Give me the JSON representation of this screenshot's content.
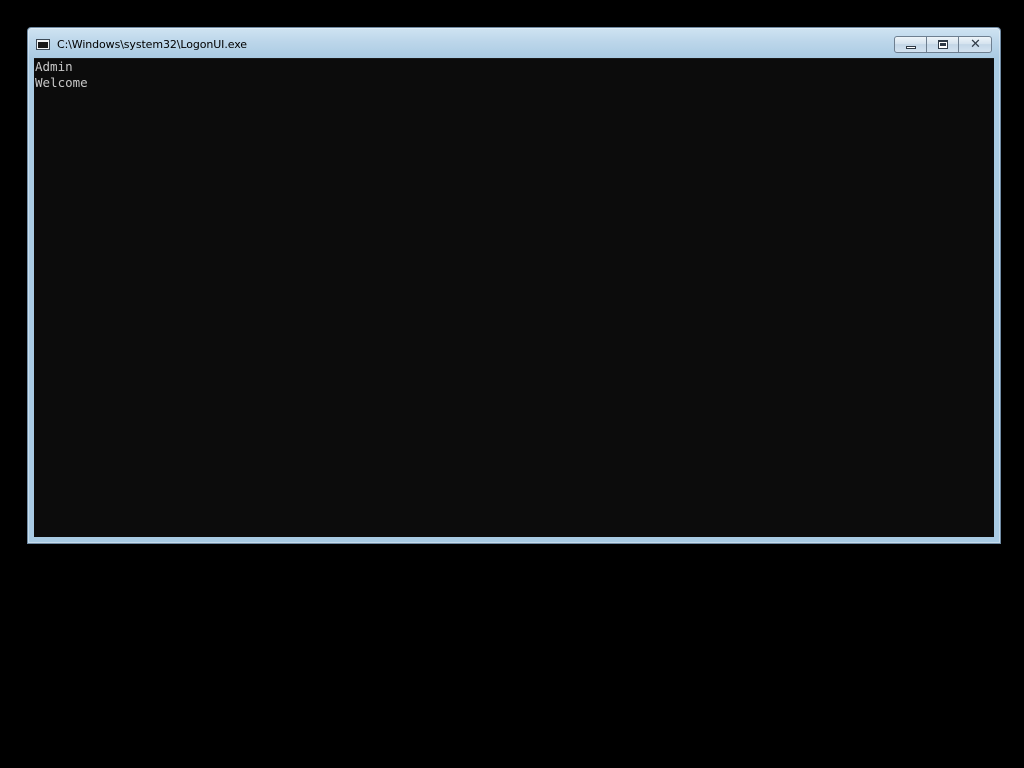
{
  "window": {
    "title": "C:\\Windows\\system32\\LogonUI.exe",
    "icon": "console-app-icon",
    "buttons": {
      "minimize": "minimize-icon",
      "maximize": "restore-icon",
      "close": "close-icon"
    }
  },
  "console": {
    "lines": [
      "Admin",
      "Welcome"
    ],
    "background_color": "#0c0c0c",
    "text_color": "#c8c8c8"
  },
  "colors": {
    "desktop": "#000000",
    "frame": "#a9cbe4"
  }
}
